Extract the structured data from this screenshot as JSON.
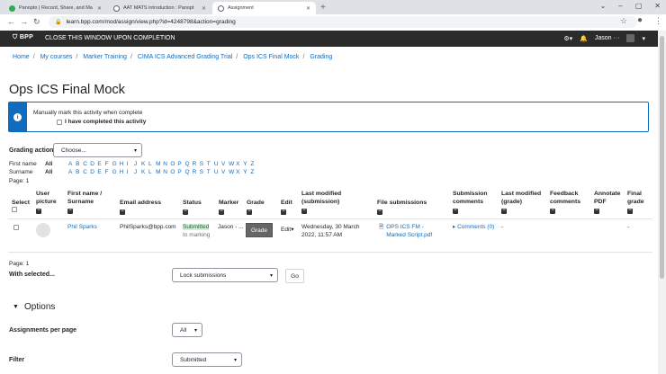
{
  "browser": {
    "tabs": [
      {
        "label": "Panopto | Record, Share, and Ma",
        "fav_color": "#34a853"
      },
      {
        "label": "AAT MATS introduction : Panopt",
        "fav_color": "#5f6368"
      },
      {
        "label": "Assignment",
        "fav_color": "#5f6368"
      }
    ],
    "url": "learn.bpp.com/mod/assign/view.php?id=4248798&action=grading"
  },
  "header": {
    "logo": "BPP",
    "message": "CLOSE THIS WINDOW UPON COMPLETION",
    "user": "Jason"
  },
  "breadcrumb": [
    "Home",
    "My courses",
    "Marker Training",
    "CIMA ICS Advanced Grading Trial",
    "Ops ICS Final Mock",
    "Grading"
  ],
  "page_title": "Ops ICS Final Mock",
  "completion": {
    "line1": "Manually mark this activity when complete",
    "line2": "I have completed this activity"
  },
  "grading_action": {
    "label": "Grading action",
    "value": "Choose..."
  },
  "initials": {
    "first_label": "First name",
    "surname_label": "Surname",
    "all": "All",
    "letters": [
      "A",
      "B",
      "C",
      "D",
      "E",
      "F",
      "G",
      "H",
      "I",
      "J",
      "K",
      "L",
      "M",
      "N",
      "O",
      "P",
      "Q",
      "R",
      "S",
      "T",
      "U",
      "V",
      "W",
      "X",
      "Y",
      "Z"
    ]
  },
  "page_label": "Page: 1",
  "table": {
    "headers": [
      "Select",
      "User picture",
      "First name / Surname",
      "Email address",
      "Status",
      "Marker",
      "Grade",
      "Edit",
      "Last modified (submission)",
      "File submissions",
      "Submission comments",
      "Last modified (grade)",
      "Feedback comments",
      "Annotate PDF",
      "Final grade"
    ],
    "row": {
      "name": "Phil Sparks",
      "email": "PhilSparks@bpp.com",
      "status_submitted": "Submitted",
      "status_marking": "In marking",
      "marker": "Jason - ...",
      "grade_button": "Grade",
      "edit": "Edit",
      "last_modified": "Wednesday, 30 March 2022, 11:57 AM",
      "file": "OPS ICS FM - Marked Script.pdf",
      "comments": "Comments (0)",
      "last_grade": "-",
      "final_grade": "-"
    }
  },
  "page_label_bottom": "Page: 1",
  "with_selected": {
    "label": "With selected...",
    "value": "Lock submissions",
    "go": "Go"
  },
  "options": {
    "heading": "Options",
    "per_page_label": "Assignments per page",
    "per_page_value": "All",
    "filter_label": "Filter",
    "filter_value": "Submitted"
  },
  "colors": {
    "brand_blue": "#0f6cbf",
    "header_dark": "#2b2b2b",
    "submitted_bg": "#d4edda"
  }
}
